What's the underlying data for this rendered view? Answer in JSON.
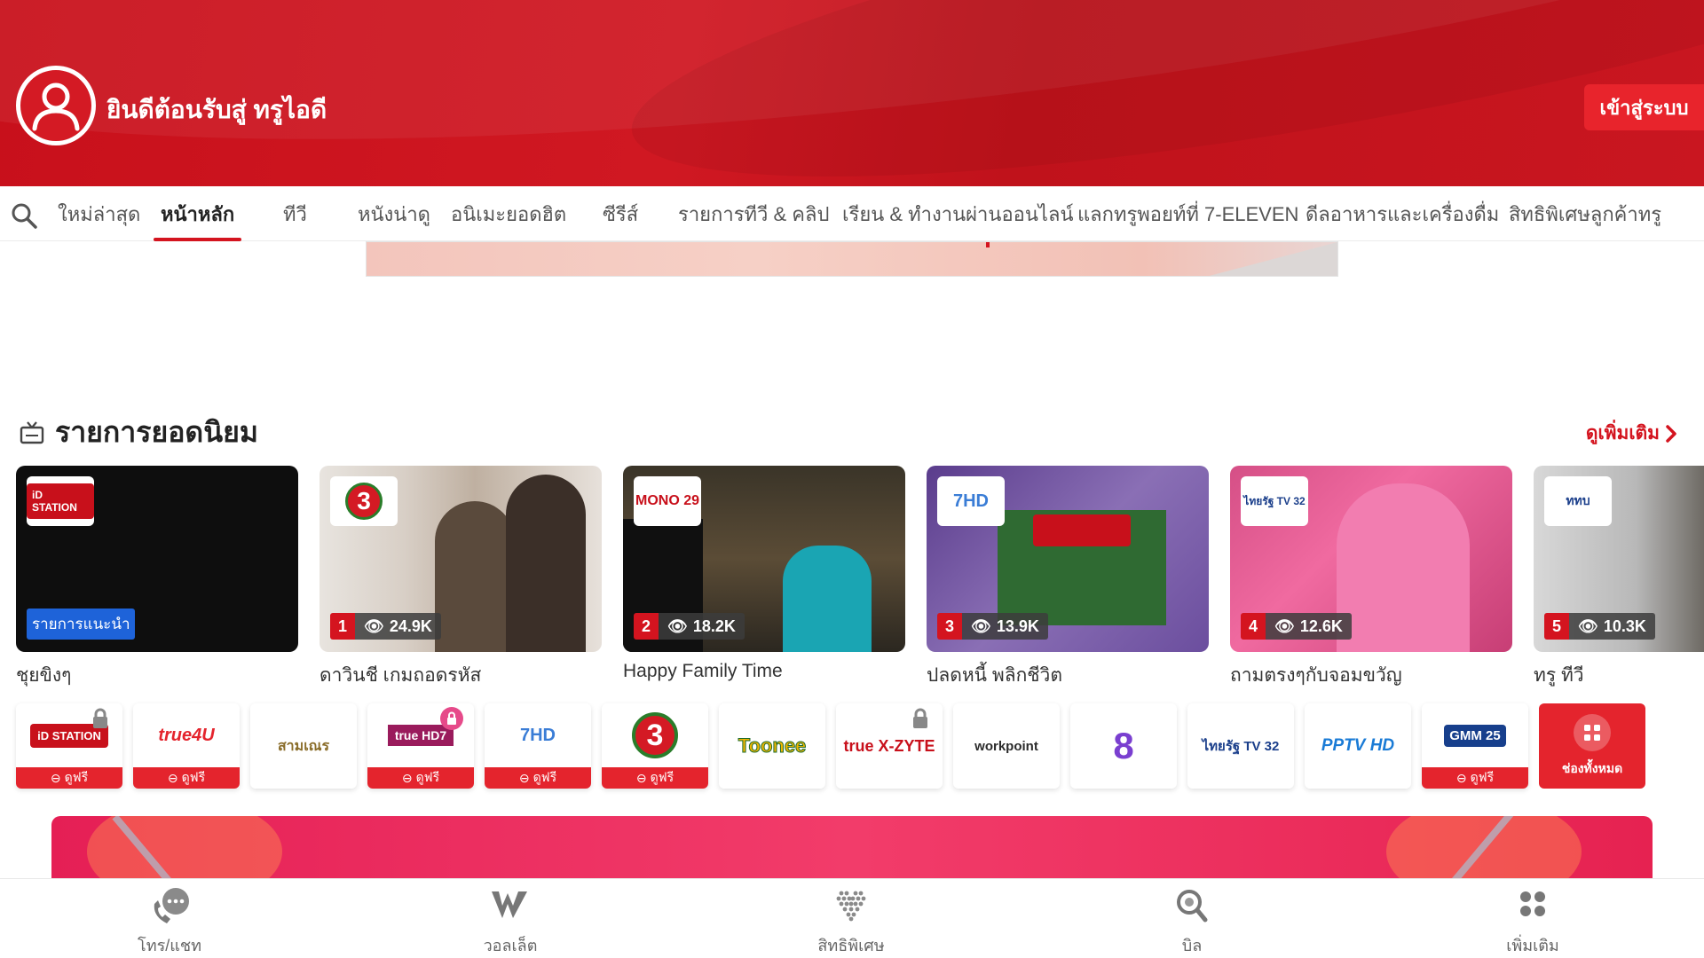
{
  "header": {
    "welcome": "ยินดีต้อนรับสู่ ทรูไอดี",
    "login_label": "เข้าสู่ระบบ"
  },
  "nav": {
    "items": [
      {
        "label": "ใหม่ล่าสุด"
      },
      {
        "label": "หน้าหลัก",
        "active": true
      },
      {
        "label": "ทีวี"
      },
      {
        "label": "หนังน่าดู"
      },
      {
        "label": "อนิเมะยอดฮิต"
      },
      {
        "label": "ซีรีส์"
      },
      {
        "label": "รายการทีวี & คลิป"
      },
      {
        "label": "เรียน & ทำงานผ่านออนไลน์"
      },
      {
        "label": "แลกทรูพอยท์ที่ 7-ELEVEN"
      },
      {
        "label": "ดีลอาหารและเครื่องดื่ม"
      },
      {
        "label": "สิทธิพิเศษลูกค้าทรู"
      }
    ]
  },
  "popular": {
    "title": "รายการยอดนิยม",
    "see_more": "ดูเพิ่มเติม",
    "cards": [
      {
        "title": "ชุยขิงๆ",
        "badge": "รายการแนะนำ",
        "logo": "iD STATION"
      },
      {
        "title": "ดาวินชี เกมถอดรหัส",
        "rank": "1",
        "views": "24.9K",
        "logo": "3"
      },
      {
        "title": "Happy Family Time",
        "rank": "2",
        "views": "18.2K",
        "logo": "MONO 29"
      },
      {
        "title": "ปลดหนี้ พลิกชีวิต",
        "rank": "3",
        "views": "13.9K",
        "logo": "7HD"
      },
      {
        "title": "ถามตรงๆกับจอมขวัญ",
        "rank": "4",
        "views": "12.6K",
        "logo": "ไทยรัฐ TV 32"
      },
      {
        "title": "ทรู ทีวี",
        "rank": "5",
        "views": "10.3K",
        "logo": "ททบ"
      }
    ]
  },
  "channels": {
    "free_label": "ดูฟรี",
    "items": [
      {
        "name": "iD STATION",
        "free": true,
        "locked": true
      },
      {
        "name": "true4U",
        "free": true
      },
      {
        "name": "สามเณร"
      },
      {
        "name": "true HD7",
        "free": true,
        "locked": true
      },
      {
        "name": "7HD",
        "free": true
      },
      {
        "name": "3",
        "free": true
      },
      {
        "name": "Toonee"
      },
      {
        "name": "true X-ZYTE",
        "locked": true
      },
      {
        "name": "workpoint"
      },
      {
        "name": "8"
      },
      {
        "name": "ไทยรัฐ TV 32"
      },
      {
        "name": "PPTV HD"
      },
      {
        "name": "GMM 25",
        "free": true
      }
    ],
    "all_label": "ช่องทั้งหมด"
  },
  "bottom_nav": {
    "items": [
      {
        "label": "โทร/แชท",
        "icon": "call-chat-icon"
      },
      {
        "label": "วอลเล็ต",
        "icon": "wallet-icon"
      },
      {
        "label": "สิทธิพิเศษ",
        "icon": "privilege-icon"
      },
      {
        "label": "บิล",
        "icon": "bill-icon"
      },
      {
        "label": "เพิ่มเติม",
        "icon": "more-icon"
      }
    ]
  },
  "colors": {
    "brand_red": "#d4141f",
    "badge_blue": "#1e63d9"
  }
}
